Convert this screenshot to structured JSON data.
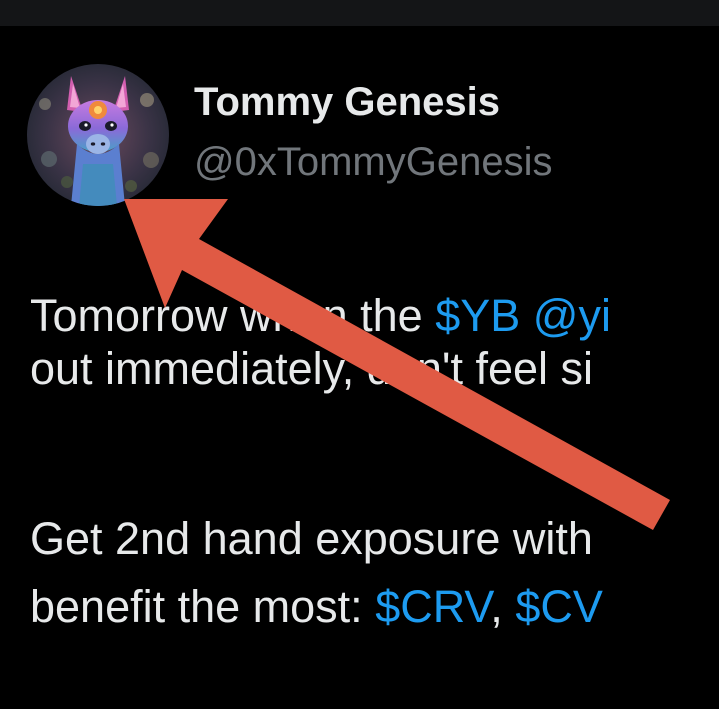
{
  "author": {
    "display_name": "Tommy Genesis",
    "handle": "@0xTommyGenesis",
    "avatar_icon": "llama-avatar-icon"
  },
  "tweet": {
    "line1": {
      "text_a": "Tomorrow when the ",
      "cashtag_yb": "$YB",
      "space": " ",
      "mention": "@yi"
    },
    "line2": {
      "text": "out immediately, don't feel si"
    },
    "line3": {
      "text": "Get 2nd hand exposure with"
    },
    "line4": {
      "text_a": "benefit the most: ",
      "cashtag_crv": "$CRV",
      "separator": ", ",
      "cashtag_cv": "$CV"
    }
  },
  "annotation": {
    "arrow_icon": "red-arrow-icon",
    "arrow_color": "#e05a44"
  },
  "colors": {
    "background": "#000000",
    "text": "#e7e9ea",
    "secondary_text": "#71767b",
    "link": "#1d9bf0"
  }
}
